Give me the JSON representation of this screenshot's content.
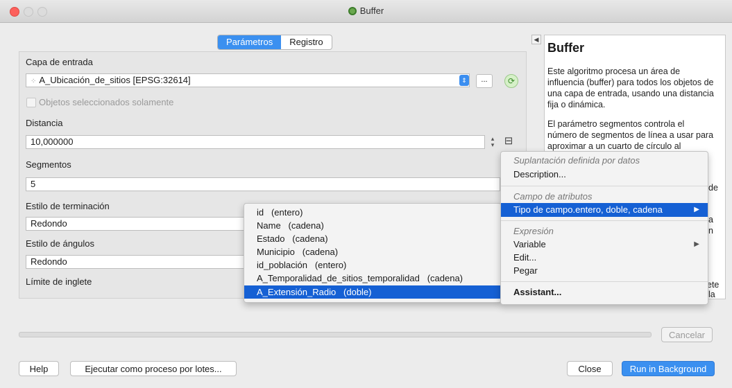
{
  "window": {
    "title": "Buffer"
  },
  "tabs": [
    {
      "label": "Parámetros",
      "active": true
    },
    {
      "label": "Registro",
      "active": false
    }
  ],
  "form": {
    "input_layer_label": "Capa de entrada",
    "input_layer_value": "A_Ubicación_de_sitios [EPSG:32614]",
    "browse_label": "...",
    "selected_only_label": "Objetos seleccionados solamente",
    "distance_label": "Distancia",
    "distance_value": "10,000000",
    "segments_label": "Segmentos",
    "segments_value": "5",
    "end_cap_label": "Estilo de terminación",
    "end_cap_value": "Redondo",
    "join_label": "Estilo de ángulos",
    "join_value": "Redondo",
    "miter_label": "Límite de inglete"
  },
  "help": {
    "title": "Buffer",
    "para1": "Este algoritmo procesa un área de influencia (buffer) para todos los objetos de una capa de entrada, usando una distancia fija o dinámica.",
    "para2": "El parámetro segmentos controla el número de segmentos de línea a usar para aproximar a un cuarto de círculo al",
    "frag1": "de",
    "frag2": "a",
    "frag3": "n",
    "frag4": "ete",
    "frag5": "la"
  },
  "override_menu": {
    "header_data_defined": "Suplantación definida por datos",
    "description": "Description...",
    "header_field": "Campo de atributos",
    "field_type": "Tipo de campo.entero, doble, cadena",
    "header_expression": "Expresión",
    "variable": "Variable",
    "edit": "Edit...",
    "paste": "Pegar",
    "assistant": "Assistant..."
  },
  "field_submenu": [
    "id   (entero)",
    "Name   (cadena)",
    "Estado   (cadena)",
    "Municipio   (cadena)",
    "id_población   (entero)",
    "A_Temporalidad_de_sitios_temporalidad   (cadena)",
    "A_Extensión_Radio   (doble)"
  ],
  "buttons": {
    "cancel": "Cancelar",
    "help": "Help",
    "batch": "Ejecutar como proceso por lotes...",
    "close": "Close",
    "run": "Run in Background"
  }
}
